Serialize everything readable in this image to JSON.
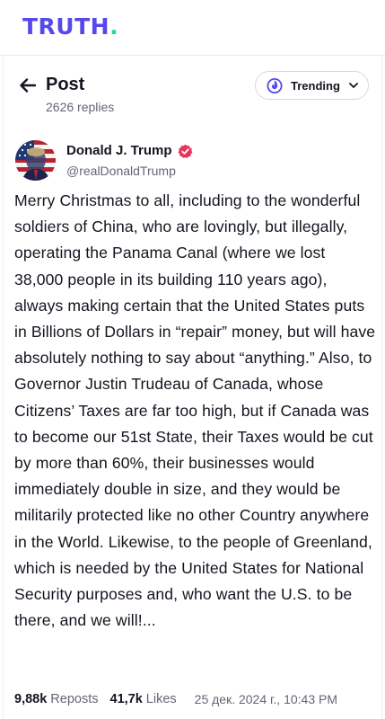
{
  "brand": {
    "logo_text": "TRUTH",
    "logo_dot": ".",
    "primary_color": "#5448ee",
    "accent_color": "#22d3b8"
  },
  "header": {
    "title": "Post",
    "subtitle": "2626 replies",
    "back_icon": "arrow-left-icon",
    "filter": {
      "label": "Trending",
      "icon": "trending-icon",
      "chevron": "chevron-down-icon"
    }
  },
  "post": {
    "author_name": "Donald J. Trump",
    "verified_icon": "verified-badge-icon",
    "handle": "@realDonaldTrump",
    "text": "Merry Christmas to all, including to the wonderful soldiers of China, who are lovingly, but illegally, operating the Panama Canal (where we lost 38,000 people in its building 110 years ago), always making certain that the United States puts in Billions of Dollars in “repair” money, but will have absolutely nothing to say about “anything.” Also, to Governor Justin Trudeau of Canada, whose Citizens’ Taxes are far too high, but if Canada was to become our 51st State, their Taxes would be cut by more than 60%, their businesses would immediately double in size, and they would be militarily protected like no other Country anywhere in the World. Likewise, to the people of Greenland, which is needed by the United States for National Security purposes and, who want the U.S. to be there, and we will!...",
    "reposts_count": "9,88k",
    "reposts_label": "Reposts",
    "likes_count": "41,7k",
    "likes_label": "Likes",
    "timestamp": "25 дек. 2024 г., 10:43 PM"
  }
}
